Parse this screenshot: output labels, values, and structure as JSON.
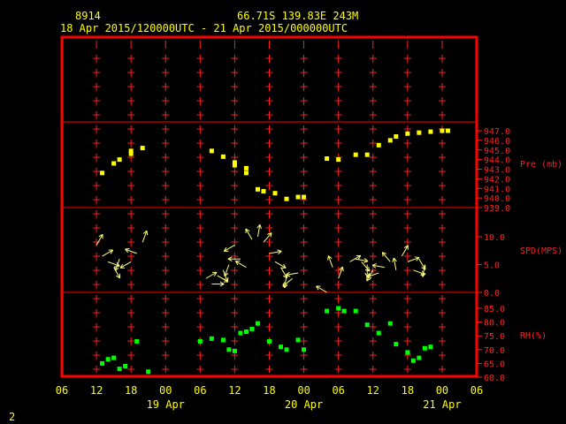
{
  "header": {
    "station_id": "8914",
    "location": "66.71S  139.83E   243M",
    "time_range": "18 Apr 2015/120000UTC - 21 Apr 2015/000000UTC"
  },
  "footer": {
    "page_number": "2"
  },
  "colors": {
    "frame": "#ff0000",
    "text": "#ffff00",
    "pressure": "#ffff00",
    "wind": "#ffff80",
    "rh": "#00ff00",
    "axis_text": "#ff2020"
  },
  "chart_data": [
    {
      "type": "scatter",
      "title": "",
      "ylabel": "Pre (mb)",
      "yticks": [
        "939.0",
        "940.0",
        "941.0",
        "942.0",
        "943.0",
        "944.0",
        "945.0",
        "946.0",
        "947.0"
      ],
      "ylim": [
        939,
        947.8
      ],
      "x": [
        13,
        15,
        16,
        18,
        18,
        20,
        32,
        34,
        36,
        36,
        38,
        38,
        40,
        41,
        43,
        45,
        47,
        48,
        52,
        54,
        57,
        59,
        61,
        63,
        64,
        66,
        68,
        70,
        72,
        73
      ],
      "values": [
        942.6,
        943.6,
        944.0,
        944.6,
        944.9,
        945.2,
        944.9,
        944.3,
        943.7,
        943.4,
        943.1,
        942.6,
        940.9,
        940.7,
        940.5,
        939.9,
        940.1,
        940.1,
        944.1,
        944.0,
        944.5,
        944.5,
        945.5,
        946.0,
        946.4,
        946.7,
        946.8,
        946.9,
        947.0,
        947.0
      ]
    },
    {
      "type": "scatter",
      "title": "",
      "ylabel": "SPD(MPS)",
      "yticks": [
        "0.0",
        "5.0",
        "10.0"
      ],
      "ylim": [
        0,
        12.5
      ],
      "x": [
        12,
        13,
        14,
        15,
        16,
        18,
        19,
        20,
        31,
        32,
        33,
        34,
        35,
        36,
        37,
        38,
        39,
        40,
        41,
        42,
        43,
        44,
        45,
        46,
        47,
        52,
        53,
        54,
        56,
        57,
        58,
        59,
        60,
        61,
        62,
        63,
        64,
        65,
        66,
        67,
        68,
        69
      ],
      "values": [
        8.5,
        6.5,
        5.5,
        4.5,
        6.0,
        5.5,
        7.0,
        9.0,
        2.5,
        1.5,
        3.0,
        4.0,
        5.0,
        8.5,
        6.0,
        4.5,
        9.5,
        10.0,
        9.0,
        7.0,
        5.5,
        4.5,
        3.0,
        2.5,
        3.5,
        0.0,
        4.5,
        2.5,
        5.5,
        6.0,
        5.5,
        5.0,
        4.0,
        3.5,
        4.5,
        5.5,
        4.0,
        6.5,
        5.5,
        4.0,
        6.0,
        5.0
      ],
      "direction_deg": [
        30,
        60,
        110,
        150,
        200,
        240,
        290,
        20,
        60,
        90,
        120,
        160,
        200,
        240,
        270,
        300,
        330,
        10,
        40,
        80,
        120,
        150,
        190,
        230,
        260,
        300,
        340,
        20,
        60,
        100,
        140,
        180,
        210,
        250,
        280,
        320,
        350,
        30,
        70,
        110,
        150,
        190
      ]
    },
    {
      "type": "scatter",
      "title": "",
      "ylabel": "RH(%)",
      "yticks": [
        "60.0",
        "65.0",
        "70.0",
        "75.0",
        "80.0",
        "85.0"
      ],
      "ylim": [
        60,
        89
      ],
      "x": [
        13,
        14,
        15,
        16,
        17,
        19,
        21,
        30,
        32,
        34,
        35,
        36,
        37,
        38,
        39,
        40,
        42,
        44,
        45,
        47,
        48,
        52,
        54,
        55,
        57,
        59,
        61,
        63,
        64,
        66,
        67,
        68,
        69,
        70
      ],
      "values": [
        65.0,
        66.5,
        67.0,
        63.0,
        64.0,
        73.0,
        62.0,
        73.0,
        74.0,
        73.5,
        70.0,
        69.5,
        76.0,
        76.5,
        77.5,
        79.5,
        73.0,
        71.0,
        70.0,
        73.5,
        70.0,
        84.0,
        85.0,
        84.0,
        84.0,
        79.0,
        76.0,
        79.5,
        72.0,
        69.0,
        66.0,
        67.0,
        70.5,
        71.0
      ]
    }
  ],
  "x_axis": {
    "ticks": [
      "06",
      "12",
      "18",
      "00",
      "06",
      "12",
      "18",
      "00",
      "06",
      "12",
      "18",
      "00",
      "06"
    ],
    "day_labels": [
      "19 Apr",
      "20 Apr",
      "21 Apr"
    ]
  }
}
